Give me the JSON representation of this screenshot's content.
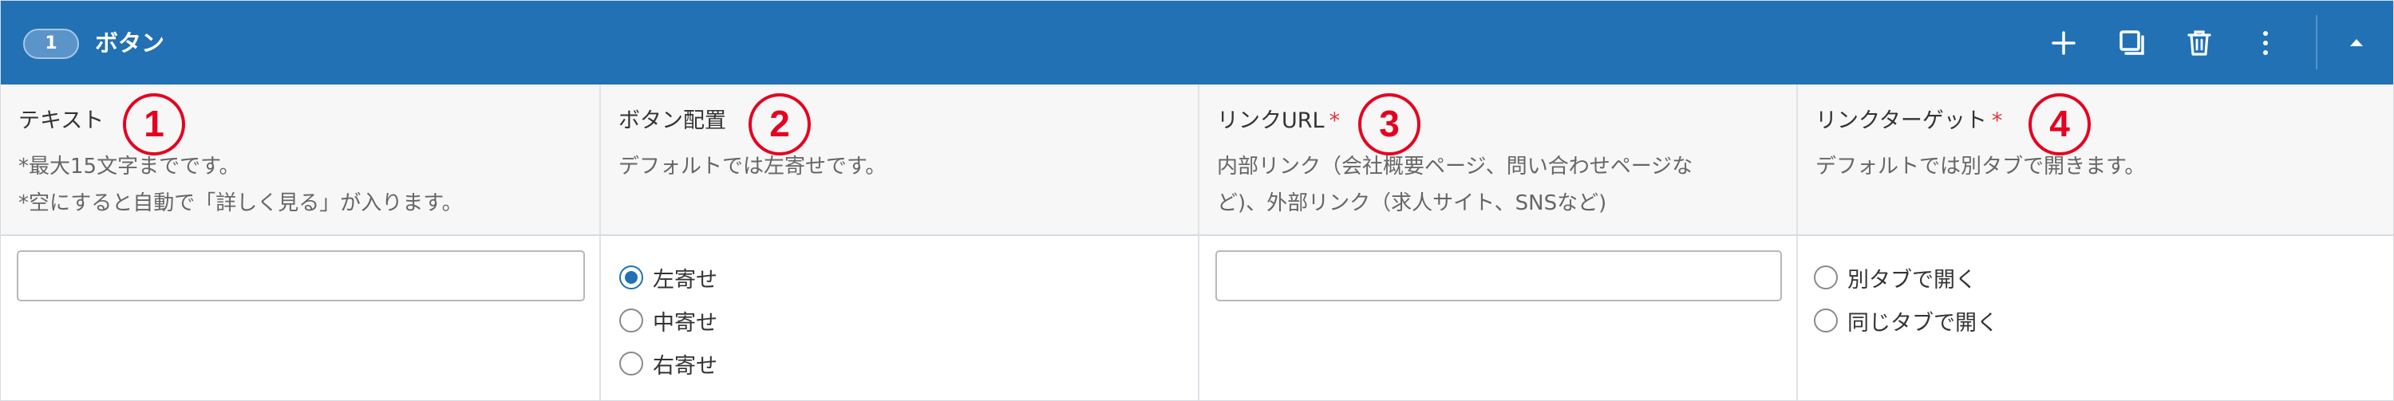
{
  "header": {
    "number": "1",
    "title": "ボタン",
    "icons": [
      "plus-icon",
      "duplicate-icon",
      "trash-icon",
      "more-vertical-icon",
      "collapse-up-icon"
    ]
  },
  "colors": {
    "header_bg": "#2171b4",
    "required_mark": "#e0343a",
    "annotation": "#e6001f",
    "radio_selected": "#2171b4"
  },
  "columns": [
    {
      "mark": "1",
      "label": "テキスト",
      "required": false,
      "desc_lines": [
        "*最大15文字までです。",
        "*空にすると自動で「詳しく見る」が入ります。"
      ]
    },
    {
      "mark": "2",
      "label": "ボタン配置",
      "required": false,
      "desc_lines": [
        "デフォルトでは左寄せです。"
      ]
    },
    {
      "mark": "3",
      "label": "リンクURL",
      "required": true,
      "required_mark": "*",
      "desc_lines": [
        "内部リンク（会社概要ページ、問い合わせページな",
        "ど)、外部リンク（求人サイト、SNSなど)"
      ]
    },
    {
      "mark": "4",
      "label": "リンクターゲット",
      "required": true,
      "required_mark": "*",
      "desc_lines": [
        "デフォルトでは別タブで開きます。"
      ]
    }
  ],
  "fields": {
    "text_value": "",
    "alignment_options": [
      {
        "label": "左寄せ",
        "checked": true
      },
      {
        "label": "中寄せ",
        "checked": false
      },
      {
        "label": "右寄せ",
        "checked": false
      }
    ],
    "url_value": "",
    "target_options": [
      {
        "label": "別タブで開く",
        "checked": false
      },
      {
        "label": "同じタブで開く",
        "checked": false
      }
    ]
  }
}
